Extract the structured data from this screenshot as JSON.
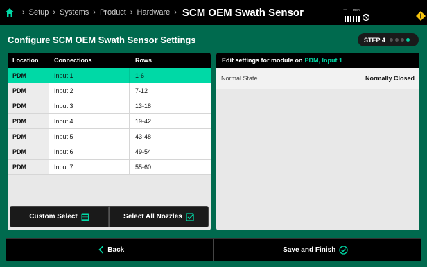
{
  "header": {
    "breadcrumbs": [
      "Setup",
      "Systems",
      "Product",
      "Hardware"
    ],
    "title": "SCM OEM Swath Sensor",
    "speed_value": "--",
    "speed_unit": "mph"
  },
  "page": {
    "heading": "Configure SCM OEM Swath Sensor Settings",
    "step_label": "STEP 4",
    "step_total": 4,
    "step_current": 4
  },
  "table": {
    "columns": [
      "Location",
      "Connections",
      "Rows"
    ],
    "rows": [
      {
        "location": "PDM",
        "connection": "Input 1",
        "rows": "1-6"
      },
      {
        "location": "PDM",
        "connection": "Input 2",
        "rows": "7-12"
      },
      {
        "location": "PDM",
        "connection": "Input 3",
        "rows": "13-18"
      },
      {
        "location": "PDM",
        "connection": "Input 4",
        "rows": "19-42"
      },
      {
        "location": "PDM",
        "connection": "Input 5",
        "rows": "43-48"
      },
      {
        "location": "PDM",
        "connection": "Input 6",
        "rows": "49-54"
      },
      {
        "location": "PDM",
        "connection": "Input 7",
        "rows": "55-60"
      }
    ],
    "selected_index": 0
  },
  "buttons": {
    "custom_select": "Custom Select",
    "select_all": "Select All Nozzles",
    "back": "Back",
    "save": "Save and Finish"
  },
  "settings": {
    "header_prefix": "Edit settings for module on",
    "module_name": "PDM, Input 1",
    "items": [
      {
        "label": "Normal State",
        "value": "Normally Closed"
      }
    ]
  },
  "colors": {
    "background": "#006a4e",
    "accent": "#00d9a6",
    "bar": "#000000"
  }
}
